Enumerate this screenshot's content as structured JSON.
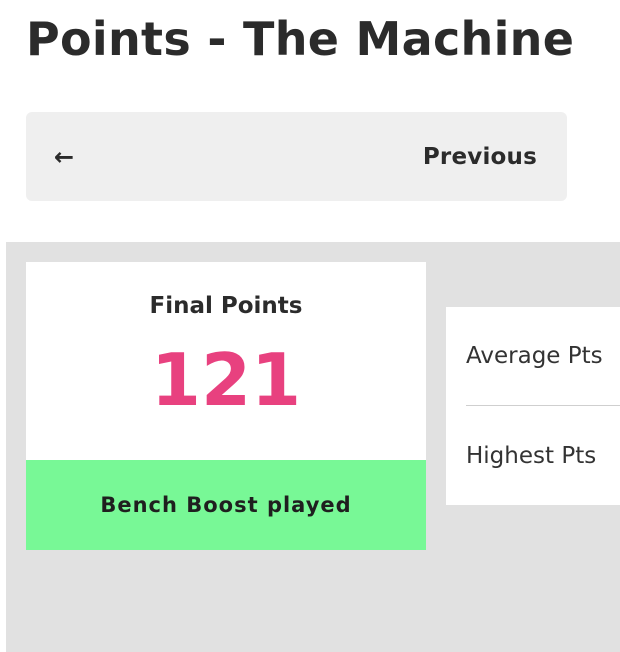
{
  "header": {
    "title": "Points - The Machine"
  },
  "navigation": {
    "previous_icon": "arrow-left-icon",
    "previous_arrow": "←",
    "previous_label": "Previous"
  },
  "scoreboard": {
    "final_points_label": "Final Points",
    "final_points_value": "121",
    "chip_played": "Bench Boost played",
    "stats": [
      {
        "label": "Average Pts"
      },
      {
        "label": "Highest Pts"
      }
    ]
  },
  "colors": {
    "points_accent": "#e8417f",
    "chip_banner": "#78f896",
    "scoreboard_background": "#e1e1e1",
    "button_background": "#efefef"
  }
}
